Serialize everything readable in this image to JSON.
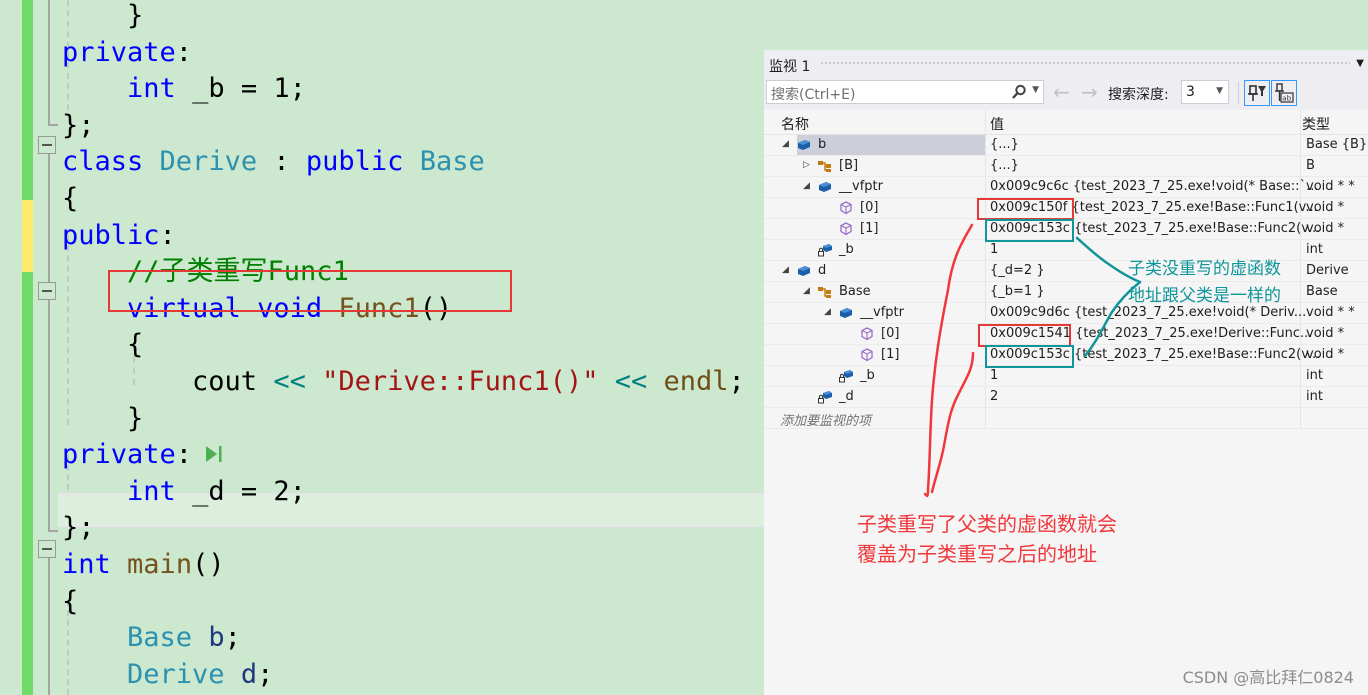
{
  "editor": {
    "lines": [
      {
        "tokens": [
          {
            "t": "    }",
            "c": ""
          }
        ]
      },
      {
        "tokens": [
          {
            "t": "private",
            "c": "kw"
          },
          {
            "t": ":",
            "c": ""
          }
        ]
      },
      {
        "tokens": [
          {
            "t": "    ",
            "c": ""
          },
          {
            "t": "int",
            "c": "kw"
          },
          {
            "t": " _b = 1;",
            "c": ""
          }
        ]
      },
      {
        "tokens": [
          {
            "t": "};",
            "c": ""
          }
        ]
      },
      {
        "tokens": [
          {
            "t": "class",
            "c": "kw"
          },
          {
            "t": " ",
            "c": ""
          },
          {
            "t": "Derive",
            "c": "ty"
          },
          {
            "t": " : ",
            "c": ""
          },
          {
            "t": "public",
            "c": "kw"
          },
          {
            "t": " ",
            "c": ""
          },
          {
            "t": "Base",
            "c": "ty"
          }
        ]
      },
      {
        "tokens": [
          {
            "t": "{",
            "c": ""
          }
        ]
      },
      {
        "tokens": [
          {
            "t": "public",
            "c": "kw"
          },
          {
            "t": ":",
            "c": ""
          }
        ]
      },
      {
        "tokens": [
          {
            "t": "    ",
            "c": ""
          },
          {
            "t": "//子类重写Func1",
            "c": "cm"
          }
        ]
      },
      {
        "tokens": [
          {
            "t": "    ",
            "c": ""
          },
          {
            "t": "virtual",
            "c": "kw"
          },
          {
            "t": " ",
            "c": ""
          },
          {
            "t": "void",
            "c": "kw"
          },
          {
            "t": " ",
            "c": ""
          },
          {
            "t": "Func1",
            "c": "fn"
          },
          {
            "t": "()",
            "c": ""
          }
        ]
      },
      {
        "tokens": [
          {
            "t": "    {",
            "c": ""
          }
        ]
      },
      {
        "tokens": [
          {
            "t": "        cout ",
            "c": ""
          },
          {
            "t": "<<",
            "c": "op"
          },
          {
            "t": " ",
            "c": ""
          },
          {
            "t": "\"Derive::Func1()\"",
            "c": "st"
          },
          {
            "t": " ",
            "c": ""
          },
          {
            "t": "<<",
            "c": "op"
          },
          {
            "t": " ",
            "c": ""
          },
          {
            "t": "endl",
            "c": "mac"
          },
          {
            "t": ";",
            "c": ""
          }
        ]
      },
      {
        "tokens": [
          {
            "t": "    }",
            "c": ""
          }
        ]
      },
      {
        "tokens": [
          {
            "t": "private",
            "c": "kw"
          },
          {
            "t": ":",
            "c": ""
          }
        ],
        "run_icon": true
      },
      {
        "tokens": [
          {
            "t": "    ",
            "c": ""
          },
          {
            "t": "int",
            "c": "kw"
          },
          {
            "t": " _d = 2;",
            "c": ""
          }
        ]
      },
      {
        "tokens": [
          {
            "t": "};",
            "c": ""
          }
        ]
      },
      {
        "tokens": [
          {
            "t": "int",
            "c": "kw"
          },
          {
            "t": " ",
            "c": ""
          },
          {
            "t": "main",
            "c": "fn"
          },
          {
            "t": "()",
            "c": ""
          }
        ]
      },
      {
        "tokens": [
          {
            "t": "{",
            "c": ""
          }
        ]
      },
      {
        "tokens": [
          {
            "t": "    ",
            "c": ""
          },
          {
            "t": "Base",
            "c": "ty"
          },
          {
            "t": " ",
            "c": ""
          },
          {
            "t": "b",
            "c": "loc"
          },
          {
            "t": ";",
            "c": ""
          }
        ]
      },
      {
        "tokens": [
          {
            "t": "    ",
            "c": ""
          },
          {
            "t": "Derive",
            "c": "ty"
          },
          {
            "t": " ",
            "c": ""
          },
          {
            "t": "d",
            "c": "loc"
          },
          {
            "t": ";",
            "c": ""
          }
        ]
      }
    ]
  },
  "watch": {
    "title": "监视 1",
    "search_placeholder": "搜索(Ctrl+E)",
    "search_depth_label": "搜索深度:",
    "search_depth_value": "3",
    "columns": {
      "name": "名称",
      "value": "值",
      "type": "类型"
    },
    "rows": [
      {
        "indent": 0,
        "expander": "expanded",
        "icon": "object-icon",
        "name": "b",
        "value": "{...}",
        "type": "Base {B}",
        "selected": true
      },
      {
        "indent": 1,
        "expander": "collapsed",
        "icon": "base-class-icon",
        "name": "[B]",
        "value": "{...}",
        "type": "B"
      },
      {
        "indent": 1,
        "expander": "expanded",
        "icon": "object-icon",
        "name": "__vfptr",
        "value": "0x009c9c6c {test_2023_7_25.exe!void(* Base::`...",
        "type": "void * *"
      },
      {
        "indent": 2,
        "expander": "none",
        "icon": "pointer-icon",
        "name": "[0]",
        "value": "0x009c150f {test_2023_7_25.exe!Base::Func1(v...",
        "type": "void *"
      },
      {
        "indent": 2,
        "expander": "none",
        "icon": "pointer-icon",
        "name": "[1]",
        "value": "0x009c153c {test_2023_7_25.exe!Base::Func2(v...",
        "type": "void *"
      },
      {
        "indent": 1,
        "expander": "none",
        "icon": "private-field-icon",
        "name": "_b",
        "value": "1",
        "type": "int"
      },
      {
        "indent": 0,
        "expander": "expanded",
        "icon": "object-icon",
        "name": "d",
        "value": "{_d=2 }",
        "type": "Derive"
      },
      {
        "indent": 1,
        "expander": "expanded",
        "icon": "base-class-icon",
        "name": "Base",
        "value": "{_b=1 }",
        "type": "Base"
      },
      {
        "indent": 2,
        "expander": "expanded",
        "icon": "object-icon",
        "name": "__vfptr",
        "value": "0x009c9d6c {test_2023_7_25.exe!void(* Deriv...",
        "type": "void * *"
      },
      {
        "indent": 3,
        "expander": "none",
        "icon": "pointer-icon",
        "name": "[0]",
        "value": "0x009c1541 {test_2023_7_25.exe!Derive::Func...",
        "type": "void *"
      },
      {
        "indent": 3,
        "expander": "none",
        "icon": "pointer-icon",
        "name": "[1]",
        "value": "0x009c153c {test_2023_7_25.exe!Base::Func2(v...",
        "type": "void *"
      },
      {
        "indent": 2,
        "expander": "none",
        "icon": "private-field-icon",
        "name": "_b",
        "value": "1",
        "type": "int"
      },
      {
        "indent": 1,
        "expander": "none",
        "icon": "private-field-icon",
        "name": "_d",
        "value": "2",
        "type": "int"
      }
    ],
    "add_item_placeholder": "添加要监视的项"
  },
  "annotations": {
    "teal_line1": "子类没重写的虚函数",
    "teal_line2": "地址跟父类是一样的",
    "red_line1": "子类重写了父类的虚函数就会",
    "red_line2": "覆盖为子类重写之后的地址",
    "teal_color": "#10959a",
    "red_color": "#f0373c"
  },
  "watermark": "CSDN @高比拜仁0824"
}
